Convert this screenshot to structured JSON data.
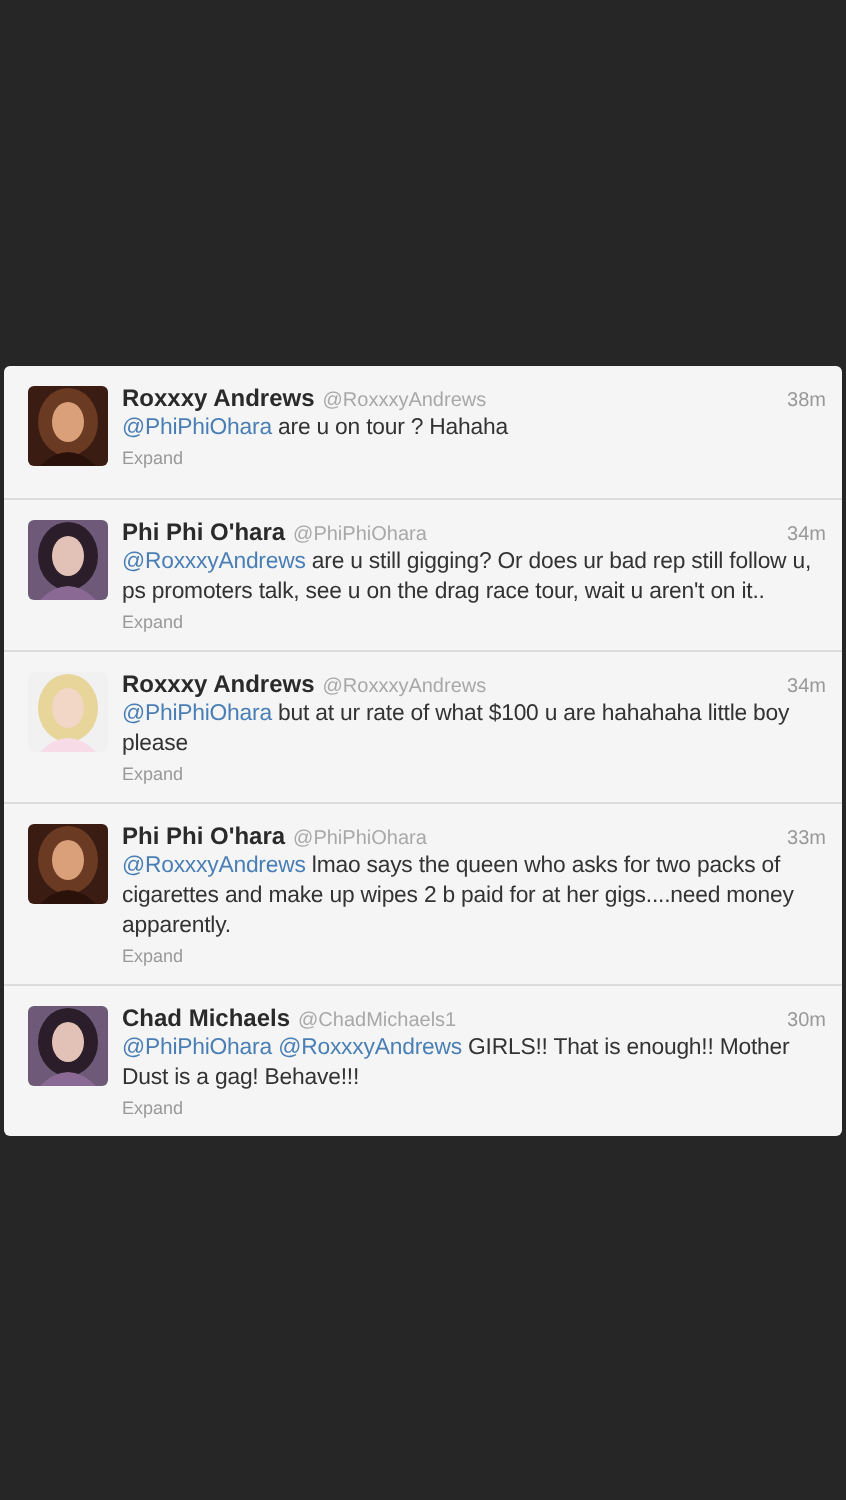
{
  "tweets": [
    {
      "name": "Roxxxy Andrews",
      "handle": "@RoxxxyAndrews",
      "time": "38m",
      "parts": [
        {
          "kind": "mention",
          "text": "@PhiPhiOhara"
        },
        {
          "kind": "text",
          "text": " are u on tour ? Hahaha"
        }
      ],
      "expand": "Expand"
    },
    {
      "name": "Phi Phi O'hara",
      "handle": "@PhiPhiOhara",
      "time": "34m",
      "parts": [
        {
          "kind": "mention",
          "text": "@RoxxxyAndrews"
        },
        {
          "kind": "text",
          "text": " are u still gigging? Or does ur bad rep still follow u, ps promoters talk, see u on the drag race tour, wait u aren't on it.."
        }
      ],
      "expand": "Expand"
    },
    {
      "name": "Roxxxy Andrews",
      "handle": "@RoxxxyAndrews",
      "time": "34m",
      "parts": [
        {
          "kind": "mention",
          "text": "@PhiPhiOhara"
        },
        {
          "kind": "text",
          "text": " but at ur rate of what $100 u are hahahaha little boy please"
        }
      ],
      "expand": "Expand"
    },
    {
      "name": "Phi Phi O'hara",
      "handle": "@PhiPhiOhara",
      "time": "33m",
      "parts": [
        {
          "kind": "mention",
          "text": "@RoxxxyAndrews"
        },
        {
          "kind": "text",
          "text": " lmao says the queen who asks for two packs of cigarettes and make up wipes 2 b paid for at her gigs....need money apparently."
        }
      ],
      "expand": "Expand"
    },
    {
      "name": "Chad Michaels",
      "handle": "@ChadMichaels1",
      "time": "30m",
      "parts": [
        {
          "kind": "mention",
          "text": "@PhiPhiOhara"
        },
        {
          "kind": "space"
        },
        {
          "kind": "mention",
          "text": "@RoxxxyAndrews"
        },
        {
          "kind": "text",
          "text": " GIRLS!! That is enough!! Mother Dust is a gag! Behave!!!"
        }
      ],
      "expand": "Expand"
    }
  ]
}
